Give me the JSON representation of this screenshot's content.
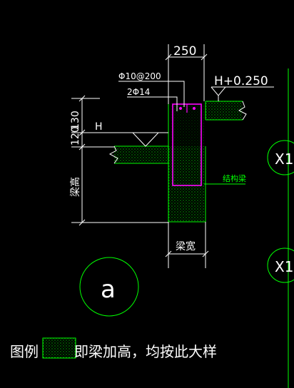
{
  "dimensions": {
    "top_width": "250",
    "elevation": "H+0.250",
    "height_130": "130",
    "height_120": "120",
    "h_mark": "H",
    "beam_height": "梁高",
    "beam_width": "梁宽"
  },
  "rebar": {
    "stirrup": "Φ10@200",
    "bars": "2Φ14"
  },
  "labels": {
    "structural_beam": "结构梁",
    "detail_letter": "a",
    "axis_1": "X1",
    "axis_2": "X1"
  },
  "legend": {
    "label": "图例",
    "description": "即梁加高，均按此大样"
  },
  "colors": {
    "background": "#000000",
    "lines": "#00ff00",
    "text": "#ffffff",
    "rebar": "#ff00ff",
    "hatch": "#00ff00"
  }
}
